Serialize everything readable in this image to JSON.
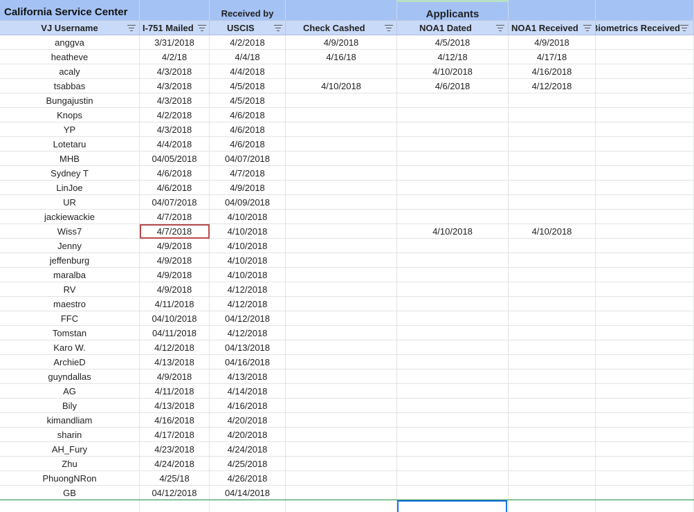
{
  "title_row": {
    "col_a": "California Service Center",
    "col_c": "Received by",
    "col_e": "Applicants"
  },
  "headers": [
    "VJ Username",
    "I-751 Mailed",
    "USCIS",
    "Check Cashed",
    "NOA1 Dated",
    "NOA1 Received",
    "Biometrics Received"
  ],
  "rows": [
    [
      "anggva",
      "3/31/2018",
      "4/2/2018",
      "4/9/2018",
      "4/5/2018",
      "4/9/2018",
      ""
    ],
    [
      "heatheve",
      "4/2/18",
      "4/4/18",
      "4/16/18",
      "4/12/18",
      "4/17/18",
      ""
    ],
    [
      "acaly",
      "4/3/2018",
      "4/4/2018",
      "",
      "4/10/2018",
      "4/16/2018",
      ""
    ],
    [
      "tsabbas",
      "4/3/2018",
      "4/5/2018",
      "4/10/2018",
      "4/6/2018",
      "4/12/2018",
      ""
    ],
    [
      "Bungajustin",
      "4/3/2018",
      "4/5/2018",
      "",
      "",
      "",
      ""
    ],
    [
      "Knops",
      "4/2/2018",
      "4/6/2018",
      "",
      "",
      "",
      ""
    ],
    [
      "YP",
      "4/3/2018",
      "4/6/2018",
      "",
      "",
      "",
      ""
    ],
    [
      "Lotetaru",
      "4/4/2018",
      "4/6/2018",
      "",
      "",
      "",
      ""
    ],
    [
      "MHB",
      "04/05/2018",
      "04/07/2018",
      "",
      "",
      "",
      ""
    ],
    [
      "Sydney T",
      "4/6/2018",
      "4/7/2018",
      "",
      "",
      "",
      ""
    ],
    [
      "LinJoe",
      "4/6/2018",
      "4/9/2018",
      "",
      "",
      "",
      ""
    ],
    [
      "UR",
      "04/07/2018",
      "04/09/2018",
      "",
      "",
      "",
      ""
    ],
    [
      "jackiewackie",
      "4/7/2018",
      "4/10/2018",
      "",
      "",
      "",
      ""
    ],
    [
      "Wiss7",
      "4/7/2018",
      "4/10/2018",
      "",
      "4/10/2018",
      "4/10/2018",
      ""
    ],
    [
      "Jenny",
      "4/9/2018",
      "4/10/2018",
      "",
      "",
      "",
      ""
    ],
    [
      "jeffenburg",
      "4/9/2018",
      "4/10/2018",
      "",
      "",
      "",
      ""
    ],
    [
      "maralba",
      "4/9/2018",
      "4/10/2018",
      "",
      "",
      "",
      ""
    ],
    [
      "RV",
      "4/9/2018",
      "4/12/2018",
      "",
      "",
      "",
      ""
    ],
    [
      "maestro",
      "4/11/2018",
      "4/12/2018",
      "",
      "",
      "",
      ""
    ],
    [
      "FFC",
      "04/10/2018",
      "04/12/2018",
      "",
      "",
      "",
      ""
    ],
    [
      "Tomstan",
      "04/11/2018",
      "4/12/2018",
      "",
      "",
      "",
      ""
    ],
    [
      "Karo W.",
      "4/12/2018",
      "04/13/2018",
      "",
      "",
      "",
      ""
    ],
    [
      "ArchieD",
      "4/13/2018",
      "04/16/2018",
      "",
      "",
      "",
      ""
    ],
    [
      "guyndallas",
      "4/9/2018",
      "4/13/2018",
      "",
      "",
      "",
      ""
    ],
    [
      "AG",
      "4/11/2018",
      "4/14/2018",
      "",
      "",
      "",
      ""
    ],
    [
      "Bily",
      "4/13/2018",
      "4/16/2018",
      "",
      "",
      "",
      ""
    ],
    [
      "kimandliam",
      "4/16/2018",
      "4/20/2018",
      "",
      "",
      "",
      ""
    ],
    [
      "sharin",
      "4/17/2018",
      "4/20/2018",
      "",
      "",
      "",
      ""
    ],
    [
      "AH_Fury",
      "4/23/2018",
      "4/24/2018",
      "",
      "",
      "",
      ""
    ],
    [
      "Zhu",
      "4/24/2018",
      "4/25/2018",
      "",
      "",
      "",
      ""
    ],
    [
      "PhuongNRon",
      "4/25/18",
      "4/26/2018",
      "",
      "",
      "",
      ""
    ],
    [
      "GB",
      "04/12/2018",
      "04/14/2018",
      "",
      "",
      "",
      ""
    ]
  ],
  "icons": {
    "filter": "filter-icon"
  },
  "colors": {
    "title_bg": "#a4c2f4",
    "header_bg": "#c9daf8",
    "selection": "#b84a4a",
    "active": "#1a73e8"
  }
}
